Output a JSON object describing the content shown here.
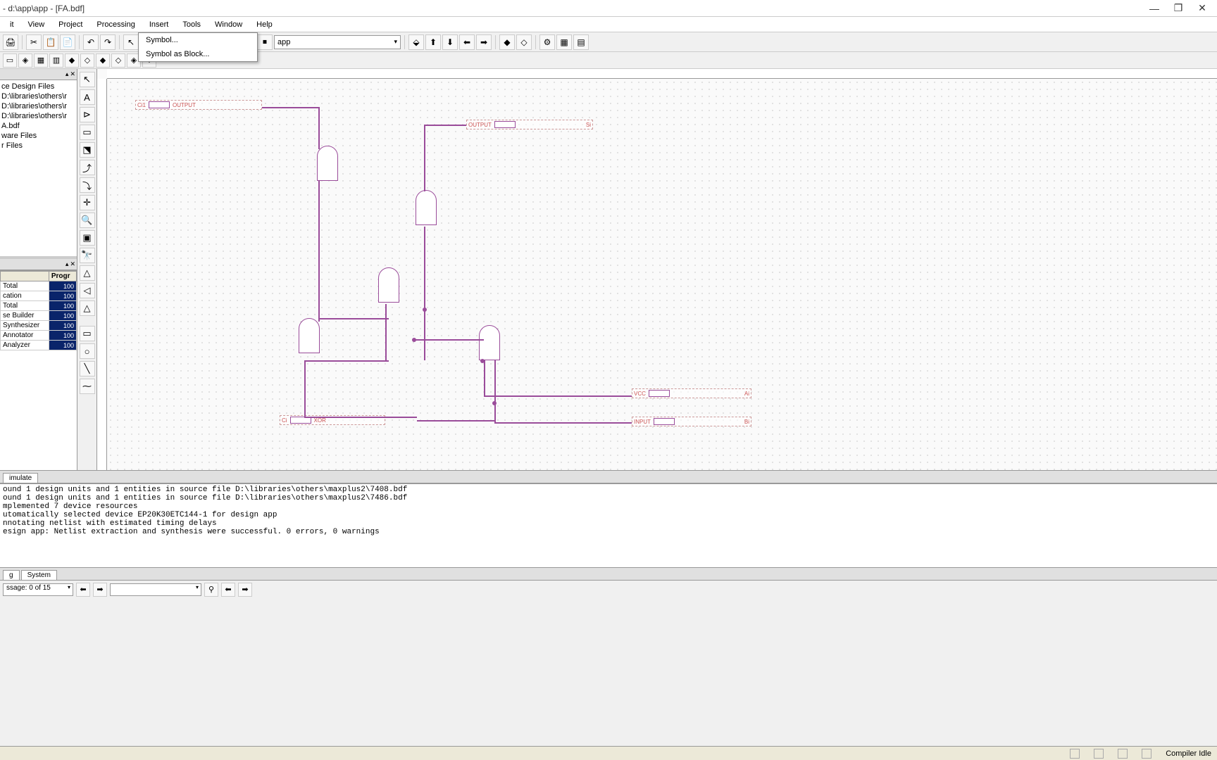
{
  "title": "- d:\\app\\app - [FA.bdf]",
  "window_buttons": {
    "min": "—",
    "max": "❐",
    "close": "✕"
  },
  "menubar": [
    "it",
    "View",
    "Project",
    "Processing",
    "Insert",
    "Tools",
    "Window",
    "Help"
  ],
  "insert_dropdown": [
    "Symbol...",
    "Symbol as Block..."
  ],
  "toolbar1_combo": "app",
  "toolbar_icons_1": [
    "🖨",
    "",
    "✂",
    "📋",
    "📄",
    "",
    "↶",
    "↷",
    "",
    "↖",
    "🔍",
    "A",
    "",
    "▶",
    "⏹"
  ],
  "toolbar_icons_1b": [
    "⬙",
    "⬆",
    "⬇",
    "⬅",
    "➡",
    "",
    "◆",
    "◇",
    "",
    "⚙",
    "▦",
    "▤"
  ],
  "toolbar_icons_2": [
    "▭",
    "◈",
    "▦",
    "▥",
    "◆",
    "◇",
    "◆",
    "◇",
    "◈",
    "◊"
  ],
  "project_tree": {
    "items": [
      "ce Design Files",
      "D:\\libraries\\others\\r",
      "D:\\libraries\\others\\r",
      "D:\\libraries\\others\\r",
      "A.bdf",
      "ware Files",
      "r Files"
    ]
  },
  "compiler_table": {
    "headers": [
      "",
      "Progr"
    ],
    "rows": [
      [
        "Total",
        "100"
      ],
      [
        "cation",
        "100"
      ],
      [
        "Total",
        "100"
      ],
      [
        "se Builder",
        "100"
      ],
      [
        "Synthesizer",
        "100"
      ],
      [
        "Annotator",
        "100"
      ],
      [
        "Analyzer",
        "100"
      ]
    ]
  },
  "vtools": [
    "↖",
    "A",
    "⊳",
    "▭",
    "⬔",
    "⤴",
    "⤵",
    "✛",
    "🔍",
    "▣",
    "🔭",
    "△",
    "◁",
    "△",
    "",
    "▭",
    "○",
    "╲",
    "⁓"
  ],
  "schematic": {
    "pins": {
      "ci1": "Ci1",
      "output1": "OUTPUT",
      "output2": "OUTPUT",
      "si": "Si",
      "ci": "Ci",
      "ai": "Ai",
      "bi": "Bi",
      "vcc": "VCC",
      "input": "INPUT",
      "xor": "XOR"
    }
  },
  "canvas_tab": "imulate",
  "messages": [
    "ound 1 design units and 1 entities in source file D:\\libraries\\others\\maxplus2\\7408.bdf",
    "ound 1 design units and 1 entities in source file D:\\libraries\\others\\maxplus2\\7486.bdf",
    "mplemented 7 device resources",
    "utomatically selected device EP20K30ETC144-1 for design app",
    "nnotating netlist with estimated timing delays",
    "esign app: Netlist extraction and synthesis  were successful. 0 errors, 0 warnings"
  ],
  "msg_tabs": [
    "g",
    "System"
  ],
  "bottombar": {
    "message_combo": "ssage: 0 of 15",
    "search_combo": ""
  },
  "statusbar": {
    "compiler": "Compiler    Idle"
  }
}
